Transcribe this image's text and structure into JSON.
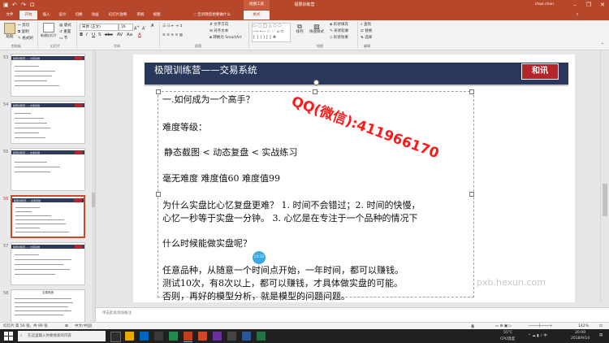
{
  "window": {
    "title": "极限训练营",
    "context_tab": "绘图工具",
    "user": "chao chen",
    "quick_access": [
      "↶",
      "↷",
      "⊡"
    ],
    "controls": [
      "–",
      "❐",
      "✕"
    ]
  },
  "tabs": [
    "文件",
    "开始",
    "插入",
    "设计",
    "切换",
    "动画",
    "幻灯片放映",
    "审阅",
    "视图",
    "格式"
  ],
  "active_tab": "开始",
  "context_active_tab": "格式",
  "tell_me": "告诉我您想要做什么",
  "ribbon": {
    "clipboard": {
      "paste": "粘贴",
      "cut": "剪切",
      "copy": "复制",
      "format_painter": "格式刷",
      "label": "剪贴板"
    },
    "slides": {
      "new_slide": "新建幻灯片",
      "layout": "版式",
      "reset": "重置",
      "section": "节",
      "label": "幻灯片"
    },
    "font": {
      "family": "宋体 (正文)",
      "size": "16",
      "label": "字体"
    },
    "paragraph": {
      "text_direction": "文字方向",
      "align_text": "对齐文本",
      "smartart": "转换为 SmartArt",
      "label": "段落"
    },
    "drawing": {
      "arrange": "排列",
      "quick_styles": "快速样式",
      "shape_fill": "形状填充",
      "shape_outline": "形状轮廓",
      "shape_effects": "形状效果",
      "label": "绘图"
    },
    "editing": {
      "find": "查找",
      "replace": "替换",
      "select": "选择",
      "label": "编辑"
    }
  },
  "thumbnails": [
    {
      "num": "53",
      "title": "极限训练营——交易系统",
      "selected": false
    },
    {
      "num": "54",
      "title": "极限训练营——交易系统",
      "selected": false
    },
    {
      "num": "55",
      "title": "极限训练营——交易系统",
      "selected": false
    },
    {
      "num": "56",
      "title": "极限训练营——交易系统",
      "selected": true
    },
    {
      "num": "57",
      "title": "极限训练营——交易系统",
      "selected": false
    },
    {
      "num": "58",
      "title": "交易系统",
      "selected": false
    }
  ],
  "slide": {
    "title": "极限训练营——交易系统",
    "logo": "和讯",
    "lines": [
      "一.如何成为一个高手？",
      "难度等级：",
      "静态截图  <  动态复盘  < 实战练习",
      "毫无难度      难度值60        难度值99",
      "为什么实盘比心忆复盘更难？ 1. 时间不会错过；2. 时间的快慢，",
      "心忆一秒等于实盘一分钟。 3. 心忆是在专注于一个品种的情况下",
      "什么时候能做实盘呢？",
      "任意品种，从随意一个时间点开始，一年时间，都可以赚钱。",
      "测试10次，有8次以上，都可以赚钱，才具体做实盘的可能。",
      "否则，再好的模型分析，就是模型的问题问题。"
    ],
    "overlay_text": "QQ(微信):411966170",
    "watermark": "pxb.hexun.com",
    "timer": "15:32"
  },
  "notes_placeholder": "单击此处添加备注",
  "status": {
    "slide_info": "幻灯片 第 56 张，共 89 张",
    "language": "中文(中国)",
    "notes": "备注",
    "zoom": "142%"
  },
  "taskbar": {
    "search_placeholder": "在这里输入你要搜索的内容",
    "temp": "55°C",
    "cpu": "CPU温度",
    "time": "20:09",
    "date": "2018/9/14"
  },
  "colors": {
    "accent": "#b7472a",
    "slide_header": "#29375b",
    "logo": "#b2262b",
    "overlay": "#ff1a1a"
  }
}
